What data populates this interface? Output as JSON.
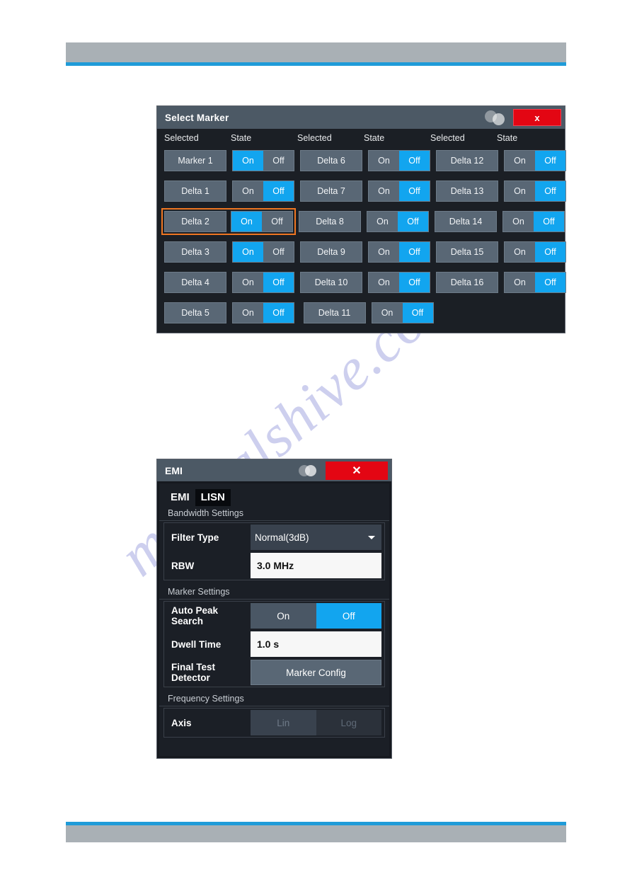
{
  "watermark": {
    "text": "manualshive.com"
  },
  "marker_dialog": {
    "title": "Select Marker",
    "close_label": "x",
    "overlap_icon": "overlapping-circles-icon",
    "headers": {
      "selected": "Selected",
      "state": "State"
    },
    "state_on": "On",
    "state_off": "Off",
    "columns": [
      {
        "rows": [
          {
            "label": "Marker 1",
            "state": "On",
            "highlighted": false
          },
          {
            "label": "Delta 1",
            "state": "Off",
            "highlighted": false
          },
          {
            "label": "Delta 2",
            "state": "On",
            "highlighted": true
          },
          {
            "label": "Delta 3",
            "state": "On",
            "highlighted": false
          },
          {
            "label": "Delta 4",
            "state": "Off",
            "highlighted": false
          },
          {
            "label": "Delta 5",
            "state": "Off",
            "highlighted": false
          }
        ]
      },
      {
        "rows": [
          {
            "label": "Delta 6",
            "state": "Off",
            "highlighted": false
          },
          {
            "label": "Delta 7",
            "state": "Off",
            "highlighted": false
          },
          {
            "label": "Delta 8",
            "state": "Off",
            "highlighted": false
          },
          {
            "label": "Delta 9",
            "state": "Off",
            "highlighted": false
          },
          {
            "label": "Delta 10",
            "state": "Off",
            "highlighted": false
          },
          {
            "label": "Delta 11",
            "state": "Off",
            "highlighted": false
          }
        ]
      },
      {
        "rows": [
          {
            "label": "Delta 12",
            "state": "Off",
            "highlighted": false
          },
          {
            "label": "Delta 13",
            "state": "Off",
            "highlighted": false
          },
          {
            "label": "Delta 14",
            "state": "Off",
            "highlighted": false
          },
          {
            "label": "Delta 15",
            "state": "Off",
            "highlighted": false
          },
          {
            "label": "Delta 16",
            "state": "Off",
            "highlighted": false
          }
        ]
      }
    ]
  },
  "emi_dialog": {
    "title": "EMI",
    "close_label": "✕",
    "overlap_icon": "overlapping-circles-icon",
    "tabs": [
      {
        "label": "EMI",
        "active": true
      },
      {
        "label": "LISN",
        "active": false
      }
    ],
    "sections": [
      {
        "label": "Bandwidth Settings",
        "rows": [
          {
            "label": "Filter Type",
            "type": "combo",
            "value": "Normal(3dB)"
          },
          {
            "label": "RBW",
            "type": "textfield",
            "value": "3.0 MHz"
          }
        ]
      },
      {
        "label": "Marker Settings",
        "rows": [
          {
            "label": "Auto Peak Search",
            "type": "toggle",
            "on_label": "On",
            "off_label": "Off",
            "value": "Off"
          },
          {
            "label": "Dwell Time",
            "type": "textfield",
            "value": "1.0 s"
          },
          {
            "label": "Final Test Detector",
            "type": "button",
            "value": "Marker Config"
          }
        ]
      },
      {
        "label": "Frequency Settings",
        "rows": [
          {
            "label": "Axis",
            "type": "toggle_disabled",
            "on_label": "Lin",
            "off_label": "Log",
            "value": "Lin"
          }
        ]
      }
    ]
  },
  "colors": {
    "accent_blue": "#12a5ef",
    "highlight_orange": "#ef7622",
    "close_red": "#e30613",
    "titlebar": "#4c5965",
    "rule_blue": "#1f9bd8",
    "header_gray": "#a9b0b5"
  }
}
